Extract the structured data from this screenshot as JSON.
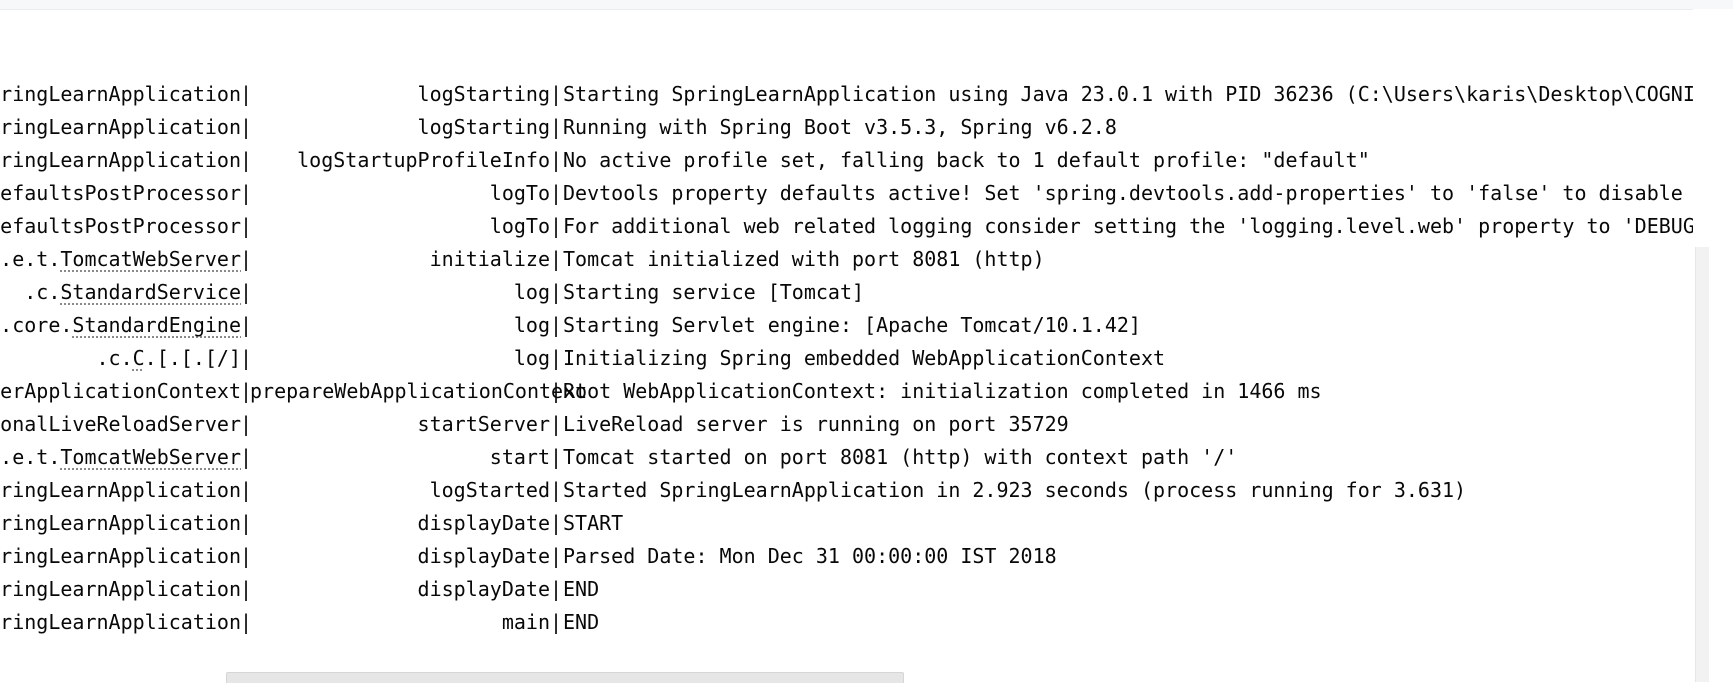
{
  "console": {
    "lines": [
      {
        "logger": "ringLearnApplication",
        "logger_link": "",
        "logger_suffix": "",
        "method": "logStarting",
        "message": "Starting SpringLearnApplication using Java 23.0.1 with PID 36236 (C:\\Users\\karis\\Desktop\\COGNIZA"
      },
      {
        "logger": "ringLearnApplication",
        "logger_link": "",
        "logger_suffix": "",
        "method": "logStarting",
        "message": "Running with Spring Boot v3.5.3, Spring v6.2.8"
      },
      {
        "logger": "ringLearnApplication",
        "logger_link": "",
        "logger_suffix": "",
        "method": "logStartupProfileInfo",
        "message": "No active profile set, falling back to 1 default profile: \"default\""
      },
      {
        "logger": "efaultsPostProcessor",
        "logger_link": "",
        "logger_suffix": "",
        "method": "logTo",
        "message": "Devtools property defaults active! Set 'spring.devtools.add-properties' to 'false' to disable"
      },
      {
        "logger": "efaultsPostProcessor",
        "logger_link": "",
        "logger_suffix": "",
        "method": "logTo",
        "message": "For additional web related logging consider setting the 'logging.level.web' property to 'DEBUG'"
      },
      {
        "logger": ".e.t.",
        "logger_link": "TomcatWebServer",
        "logger_suffix": "",
        "method": "initialize",
        "message": "Tomcat initialized with port 8081 (http)"
      },
      {
        "logger": ".c.",
        "logger_link": "StandardService",
        "logger_suffix": "  ",
        "method": "log",
        "message": "Starting service [Tomcat]"
      },
      {
        "logger": ".core.",
        "logger_link": "StandardEngine",
        "logger_suffix": "",
        "method": "log",
        "message": "Starting Servlet engine: [Apache Tomcat/10.1.42]"
      },
      {
        "logger": ".c.",
        "logger_link": "C",
        "logger_suffix": ".[.[.[/]        ",
        "method": "log",
        "message": "Initializing Spring embedded WebApplicationContext"
      },
      {
        "logger": "erApplicationContext",
        "logger_link": "",
        "logger_suffix": "",
        "method": "prepareWebApplicationContext",
        "message": "Root WebApplicationContext: initialization completed in 1466 ms"
      },
      {
        "logger": "onalLiveReloadServer",
        "logger_link": "",
        "logger_suffix": "",
        "method": "startServer",
        "message": "LiveReload server is running on port 35729"
      },
      {
        "logger": ".e.t.",
        "logger_link": "TomcatWebServer",
        "logger_suffix": "",
        "method": "start",
        "message": "Tomcat started on port 8081 (http) with context path '/'"
      },
      {
        "logger": "ringLearnApplication",
        "logger_link": "",
        "logger_suffix": "",
        "method": "logStarted",
        "message": "Started SpringLearnApplication in 2.923 seconds (process running for 3.631)"
      },
      {
        "logger": "ringLearnApplication",
        "logger_link": "",
        "logger_suffix": "",
        "method": "displayDate",
        "message": "START"
      },
      {
        "logger": "ringLearnApplication",
        "logger_link": "",
        "logger_suffix": "",
        "method": "displayDate",
        "message": "Parsed Date: Mon Dec 31 00:00:00 IST 2018"
      },
      {
        "logger": "ringLearnApplication",
        "logger_link": "",
        "logger_suffix": "",
        "method": "displayDate",
        "message": "END"
      },
      {
        "logger": "ringLearnApplication",
        "logger_link": "",
        "logger_suffix": "",
        "method": "main",
        "message": "END"
      }
    ],
    "separator": "|"
  }
}
